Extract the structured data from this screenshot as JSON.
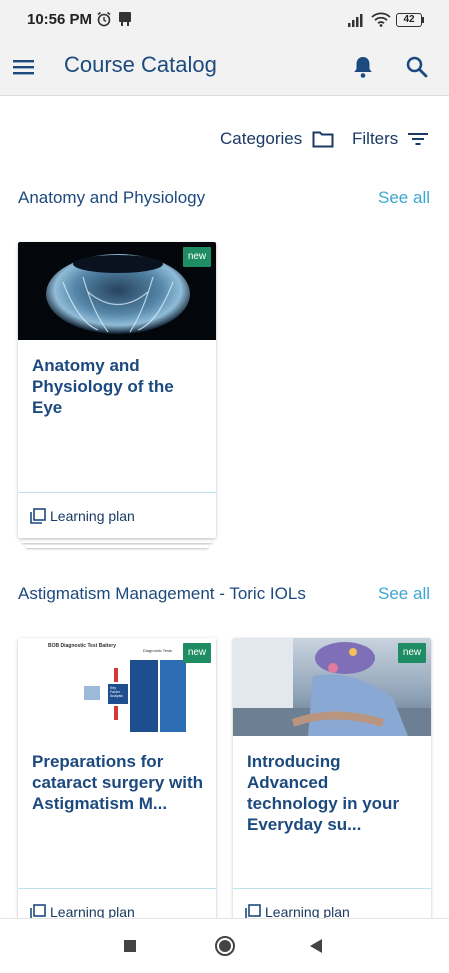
{
  "status_bar": {
    "time": "10:56 PM",
    "battery": "42",
    "icons": [
      "alarm-icon",
      "notification-icon",
      "signal-icon",
      "wifi-icon",
      "battery-icon"
    ]
  },
  "app_bar": {
    "title": "Course Catalog",
    "icons": [
      "menu-icon",
      "bell-icon",
      "search-icon"
    ],
    "accent_color": "#1d4a7e"
  },
  "toolbar": {
    "categories_label": "Categories",
    "filters_label": "Filters"
  },
  "sections": [
    {
      "title": "Anatomy and Physiology",
      "see_all": "See all",
      "cards": [
        {
          "title": "Anatomy and Physiology of the Eye",
          "badge": "new",
          "type": "Learning plan"
        }
      ]
    },
    {
      "title": "Astigmatism Management - Toric IOLs",
      "see_all": "See all",
      "cards": [
        {
          "title": "Preparations for cataract surgery with Astigmatism M...",
          "badge": "new",
          "type": "Learning plan"
        },
        {
          "title": "Introducing Advanced technology in your Everyday su...",
          "badge": "new",
          "type": "Learning plan"
        }
      ]
    }
  ],
  "thumbnail_text": {
    "header": "BOB Diagnostic Test Battery",
    "tests": "Diagnostic Tests",
    "box": "Key Factor Analysis"
  },
  "colors": {
    "badge": "#1f8d63",
    "link": "#3ea7d1",
    "heading": "#1d4a7e"
  },
  "nav_bar": {
    "icons": [
      "recents-icon",
      "home-icon",
      "back-icon"
    ]
  }
}
